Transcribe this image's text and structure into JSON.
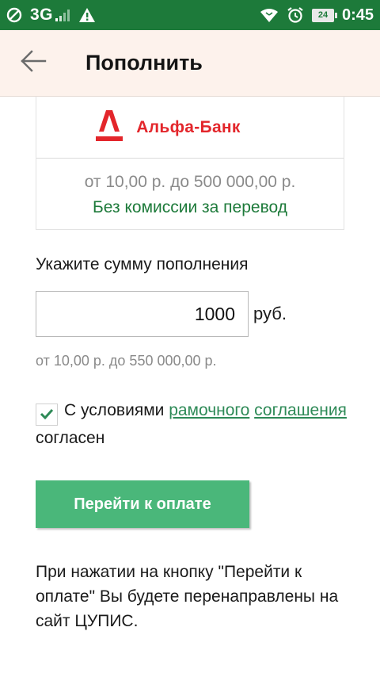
{
  "statusbar": {
    "network": "3G",
    "battery_level": "24",
    "time": "0:45",
    "icons": [
      "no-sim-icon",
      "signal-icon",
      "warning-icon",
      "wifi-icon",
      "alarm-icon",
      "battery-icon"
    ],
    "color": "#1d7a3a"
  },
  "appbar": {
    "title": "Пополнить",
    "background": "#fdf2ec"
  },
  "bank": {
    "name": "Альфа-Банк",
    "range": "от 10,00 р. до 500 000,00 р.",
    "commission": "Без комиссии за перевод",
    "brand_color": "#e3262b"
  },
  "form": {
    "amount_label": "Укажите сумму пополнения",
    "amount_value": "1000",
    "currency": "руб.",
    "limits": "от 10,00 р. до 550 000,00 р."
  },
  "agreement": {
    "checked": true,
    "prefix": "С условиями",
    "link_text_1": "рамочного",
    "link_text_2": "соглашения",
    "suffix": "согласен"
  },
  "pay_button": {
    "label": "Перейти к оплате",
    "color": "#4ab77a"
  },
  "note": "При нажатии на кнопку \"Перейти к оплате\" Вы будете перенаправлены на сайт ЦУПИС."
}
